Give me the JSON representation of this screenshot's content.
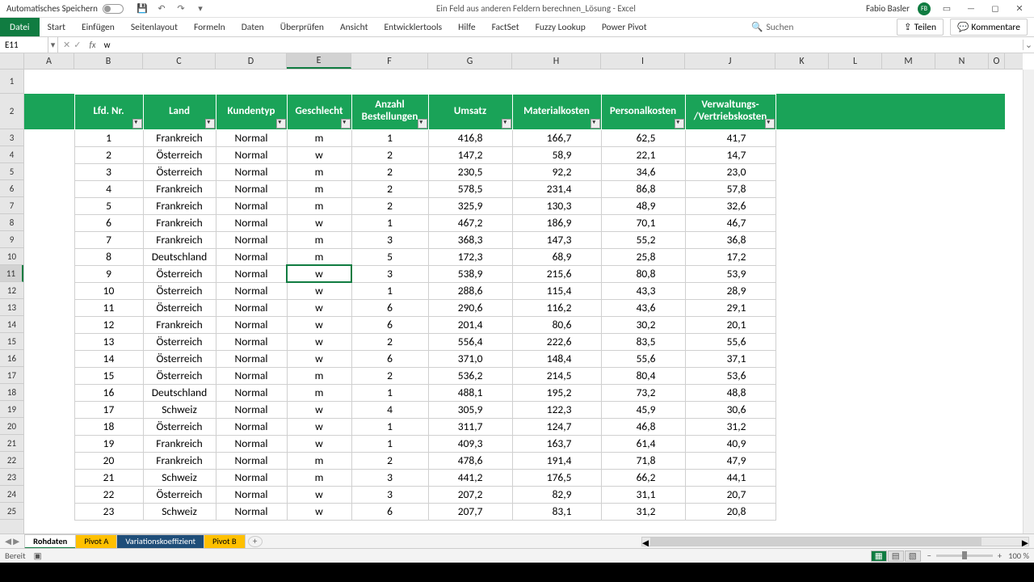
{
  "titlebar": {
    "autosave_label": "Automatisches Speichern",
    "doc_title": "Ein Feld aus anderen Feldern berechnen_Lösung  -  Excel",
    "user_name": "Fabio Basler",
    "user_initials": "FB"
  },
  "ribbon": {
    "file": "Datei",
    "tabs": [
      "Start",
      "Einfügen",
      "Seitenlayout",
      "Formeln",
      "Daten",
      "Überprüfen",
      "Ansicht",
      "Entwicklertools",
      "Hilfe",
      "FactSet",
      "Fuzzy Lookup",
      "Power Pivot"
    ],
    "search_placeholder": "Suchen",
    "share": "Teilen",
    "comments": "Kommentare"
  },
  "formula_bar": {
    "cell_ref": "E11",
    "value": "w"
  },
  "columns": [
    {
      "letter": "A",
      "w": 62
    },
    {
      "letter": "B",
      "w": 85
    },
    {
      "letter": "C",
      "w": 90
    },
    {
      "letter": "D",
      "w": 88
    },
    {
      "letter": "E",
      "w": 80
    },
    {
      "letter": "F",
      "w": 95
    },
    {
      "letter": "G",
      "w": 104
    },
    {
      "letter": "H",
      "w": 110
    },
    {
      "letter": "I",
      "w": 104
    },
    {
      "letter": "J",
      "w": 112
    },
    {
      "letter": "K",
      "w": 66
    },
    {
      "letter": "L",
      "w": 66
    },
    {
      "letter": "M",
      "w": 66
    },
    {
      "letter": "N",
      "w": 66
    },
    {
      "letter": "O",
      "w": 20
    }
  ],
  "row_heights": {
    "r1": 30,
    "r2": 44,
    "default": 21
  },
  "active": {
    "col": "E",
    "row": 11
  },
  "table": {
    "headers": [
      "Lfd. Nr.",
      "Land",
      "Kundentyp",
      "Geschlecht",
      "Anzahl Bestellungen",
      "Umsatz",
      "Materialkosten",
      "Personalkosten",
      "Verwaltungs-/Vertriebskosten"
    ],
    "rows": [
      [
        1,
        "Frankreich",
        "Normal",
        "m",
        1,
        "416,8",
        "166,7",
        "62,5",
        "41,7"
      ],
      [
        2,
        "Österreich",
        "Normal",
        "w",
        2,
        "147,2",
        "58,9",
        "22,1",
        "14,7"
      ],
      [
        3,
        "Österreich",
        "Normal",
        "m",
        2,
        "230,5",
        "92,2",
        "34,6",
        "23,0"
      ],
      [
        4,
        "Frankreich",
        "Normal",
        "m",
        2,
        "578,5",
        "231,4",
        "86,8",
        "57,8"
      ],
      [
        5,
        "Frankreich",
        "Normal",
        "m",
        2,
        "325,9",
        "130,3",
        "48,9",
        "32,6"
      ],
      [
        6,
        "Frankreich",
        "Normal",
        "w",
        1,
        "467,2",
        "186,9",
        "70,1",
        "46,7"
      ],
      [
        7,
        "Frankreich",
        "Normal",
        "m",
        3,
        "368,3",
        "147,3",
        "55,2",
        "36,8"
      ],
      [
        8,
        "Deutschland",
        "Normal",
        "m",
        5,
        "172,3",
        "68,9",
        "25,8",
        "17,2"
      ],
      [
        9,
        "Österreich",
        "Normal",
        "w",
        3,
        "538,9",
        "215,6",
        "80,8",
        "53,9"
      ],
      [
        10,
        "Österreich",
        "Normal",
        "w",
        1,
        "288,6",
        "115,4",
        "43,3",
        "28,9"
      ],
      [
        11,
        "Österreich",
        "Normal",
        "w",
        6,
        "290,6",
        "116,2",
        "43,6",
        "29,1"
      ],
      [
        12,
        "Frankreich",
        "Normal",
        "w",
        6,
        "201,4",
        "80,6",
        "30,2",
        "20,1"
      ],
      [
        13,
        "Österreich",
        "Normal",
        "w",
        2,
        "556,4",
        "222,6",
        "83,5",
        "55,6"
      ],
      [
        14,
        "Österreich",
        "Normal",
        "w",
        6,
        "371,0",
        "148,4",
        "55,6",
        "37,1"
      ],
      [
        15,
        "Österreich",
        "Normal",
        "m",
        2,
        "536,2",
        "214,5",
        "80,4",
        "53,6"
      ],
      [
        16,
        "Deutschland",
        "Normal",
        "m",
        1,
        "488,1",
        "195,2",
        "73,2",
        "48,8"
      ],
      [
        17,
        "Schweiz",
        "Normal",
        "w",
        4,
        "305,9",
        "122,3",
        "45,9",
        "30,6"
      ],
      [
        18,
        "Österreich",
        "Normal",
        "w",
        1,
        "311,7",
        "124,7",
        "46,8",
        "31,2"
      ],
      [
        19,
        "Frankreich",
        "Normal",
        "w",
        1,
        "409,3",
        "163,7",
        "61,4",
        "40,9"
      ],
      [
        20,
        "Frankreich",
        "Normal",
        "m",
        2,
        "478,6",
        "191,4",
        "71,8",
        "47,9"
      ],
      [
        21,
        "Schweiz",
        "Normal",
        "m",
        3,
        "441,2",
        "176,5",
        "66,2",
        "44,1"
      ],
      [
        22,
        "Österreich",
        "Normal",
        "w",
        3,
        "207,2",
        "82,9",
        "31,1",
        "20,7"
      ],
      [
        23,
        "Schweiz",
        "Normal",
        "w",
        6,
        "207,7",
        "83,1",
        "31,2",
        "20,8"
      ]
    ]
  },
  "sheet_tabs": [
    "Rohdaten",
    "Pivot A",
    "Variationskoeffizient",
    "Pivot B"
  ],
  "status": {
    "ready": "Bereit",
    "zoom": "100 %"
  }
}
